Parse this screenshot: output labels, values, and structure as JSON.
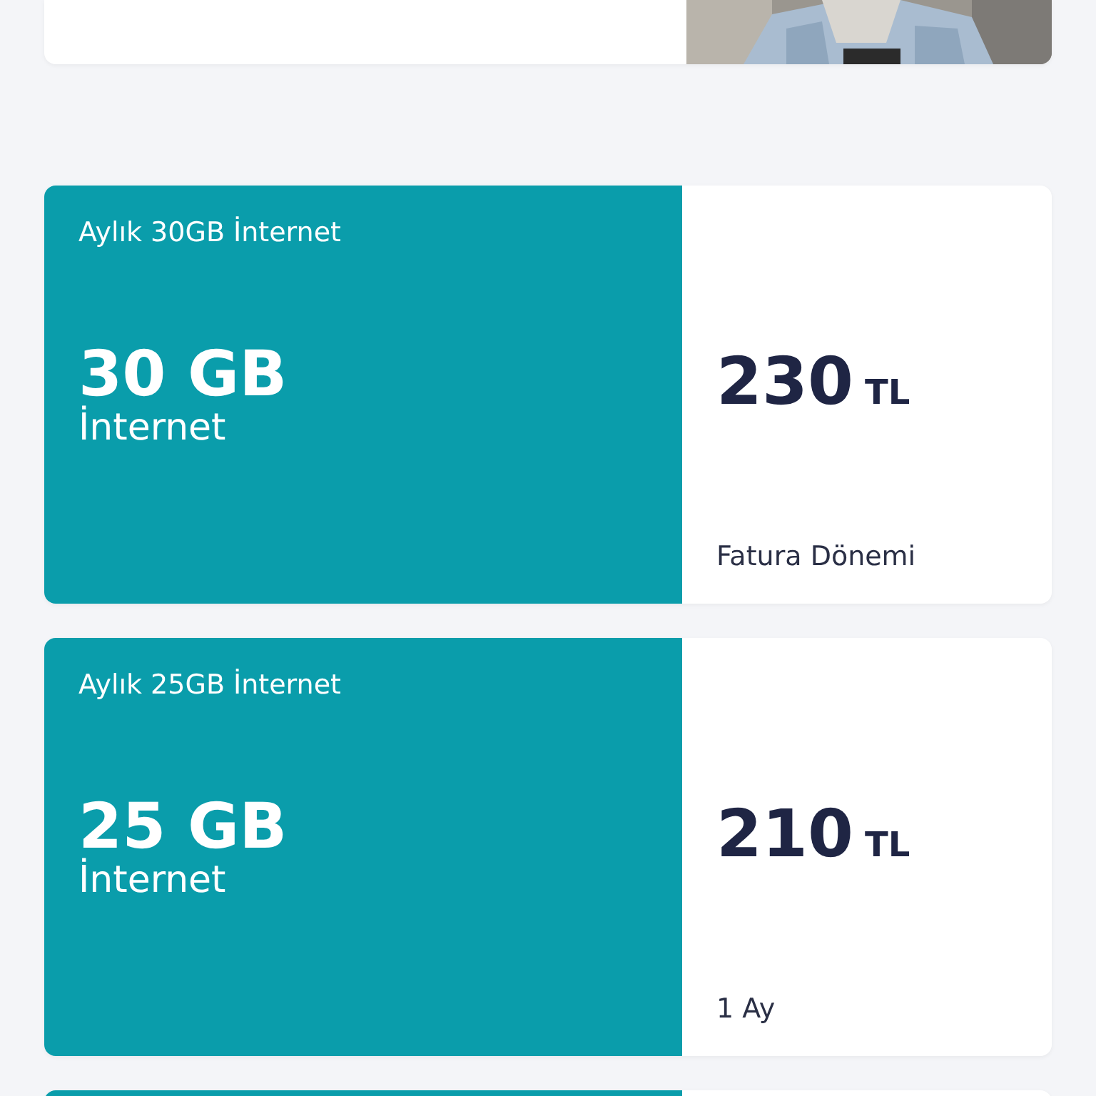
{
  "packages": [
    {
      "title": "Aylık 30GB İnternet",
      "amount": "30 GB",
      "unit": "İnternet",
      "price": "230",
      "currency": "TL",
      "period": "Fatura Dönemi"
    },
    {
      "title": "Aylık 25GB İnternet",
      "amount": "25 GB",
      "unit": "İnternet",
      "price": "210",
      "currency": "TL",
      "period": "1 Ay"
    }
  ],
  "next_card": {
    "kind": "package"
  }
}
